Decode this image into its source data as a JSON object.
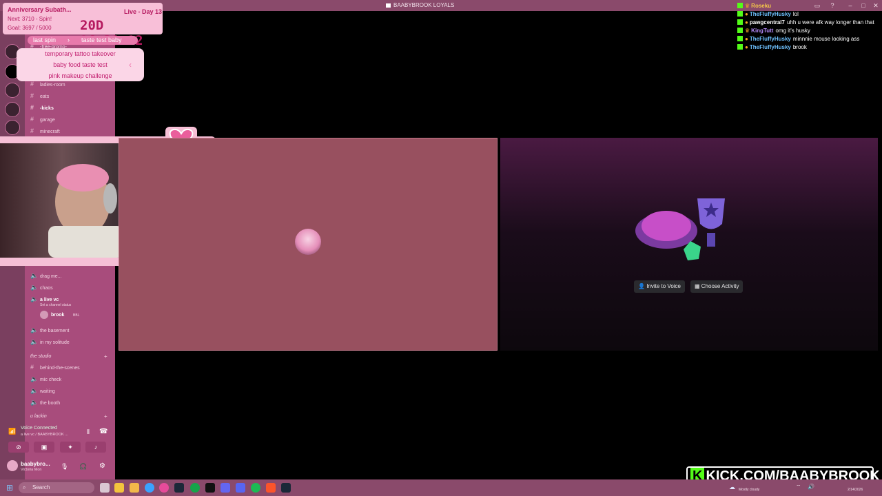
{
  "window": {
    "title": "BAABYBROOK LOYALS"
  },
  "subathon": {
    "title": "Anniversary Subath...",
    "next": "Next: 3710 - Spin!",
    "goal": "Goal: 3697 / 5000",
    "day": "Live - Day 13",
    "timer": "20D 16:30:12"
  },
  "spin": {
    "last_label": "last spin",
    "last_value": "taste test baby",
    "options": [
      "temporary tattoo takeover",
      "baby food taste test",
      "pink makeup challenge"
    ]
  },
  "channels_top": [
    {
      "name": "-free-promo-"
    },
    {
      "name": "ladies-room"
    },
    {
      "name": "eats"
    },
    {
      "name": "-kicks",
      "bold": true
    },
    {
      "name": "garage"
    },
    {
      "name": "minecraft"
    }
  ],
  "voice_channels": [
    {
      "name": "drag me..."
    },
    {
      "name": "chaos"
    },
    {
      "name": "a live vc",
      "active": true,
      "status": "Set a channel status",
      "member": "brook",
      "member_tag": "BBL"
    },
    {
      "name": "the basement"
    },
    {
      "name": "in my solitude"
    }
  ],
  "category_studio": {
    "name": "the studio",
    "channels": [
      "behind-the-scenes",
      "mic check",
      "waiting",
      "the booth"
    ]
  },
  "category_lackin": {
    "name": "u lackin"
  },
  "voice_panel": {
    "status": "Voice Connected",
    "channel": "a live vc / BAABYBROOK ..."
  },
  "user_panel": {
    "name": "baabybro...",
    "status": "Victoria Mon"
  },
  "activity": {
    "invite_label": "Invite to Voice",
    "choose_label": "Choose Activity"
  },
  "chat": [
    {
      "user": "Roseku",
      "text": "",
      "color": "#f7c948"
    },
    {
      "user": "TheFluffyHusky",
      "text": "lol",
      "color": "#6ec1ff"
    },
    {
      "user": "pawgcentral7",
      "text": "uhh u were afk way longer than that",
      "color": "#ffffff"
    },
    {
      "user": "KingTutt",
      "text": "omg it's husky",
      "color": "#b88cff"
    },
    {
      "user": "TheFluffyHusky",
      "text": "minnnie mouse looking ass",
      "color": "#6ec1ff"
    },
    {
      "user": "TheFluffyHusky",
      "text": "brook",
      "color": "#6ec1ff"
    }
  ],
  "kick": {
    "k": "K",
    "url": "KICK.COM/BAABYBROOK"
  },
  "taskbar": {
    "search_placeholder": "Search",
    "weather": "Mostly cloudy",
    "date": "2/14/2026"
  },
  "colors": {
    "accent_pink": "#f8bfd8",
    "kick_green": "#53fc18",
    "sidebar": "#a84c7c"
  }
}
